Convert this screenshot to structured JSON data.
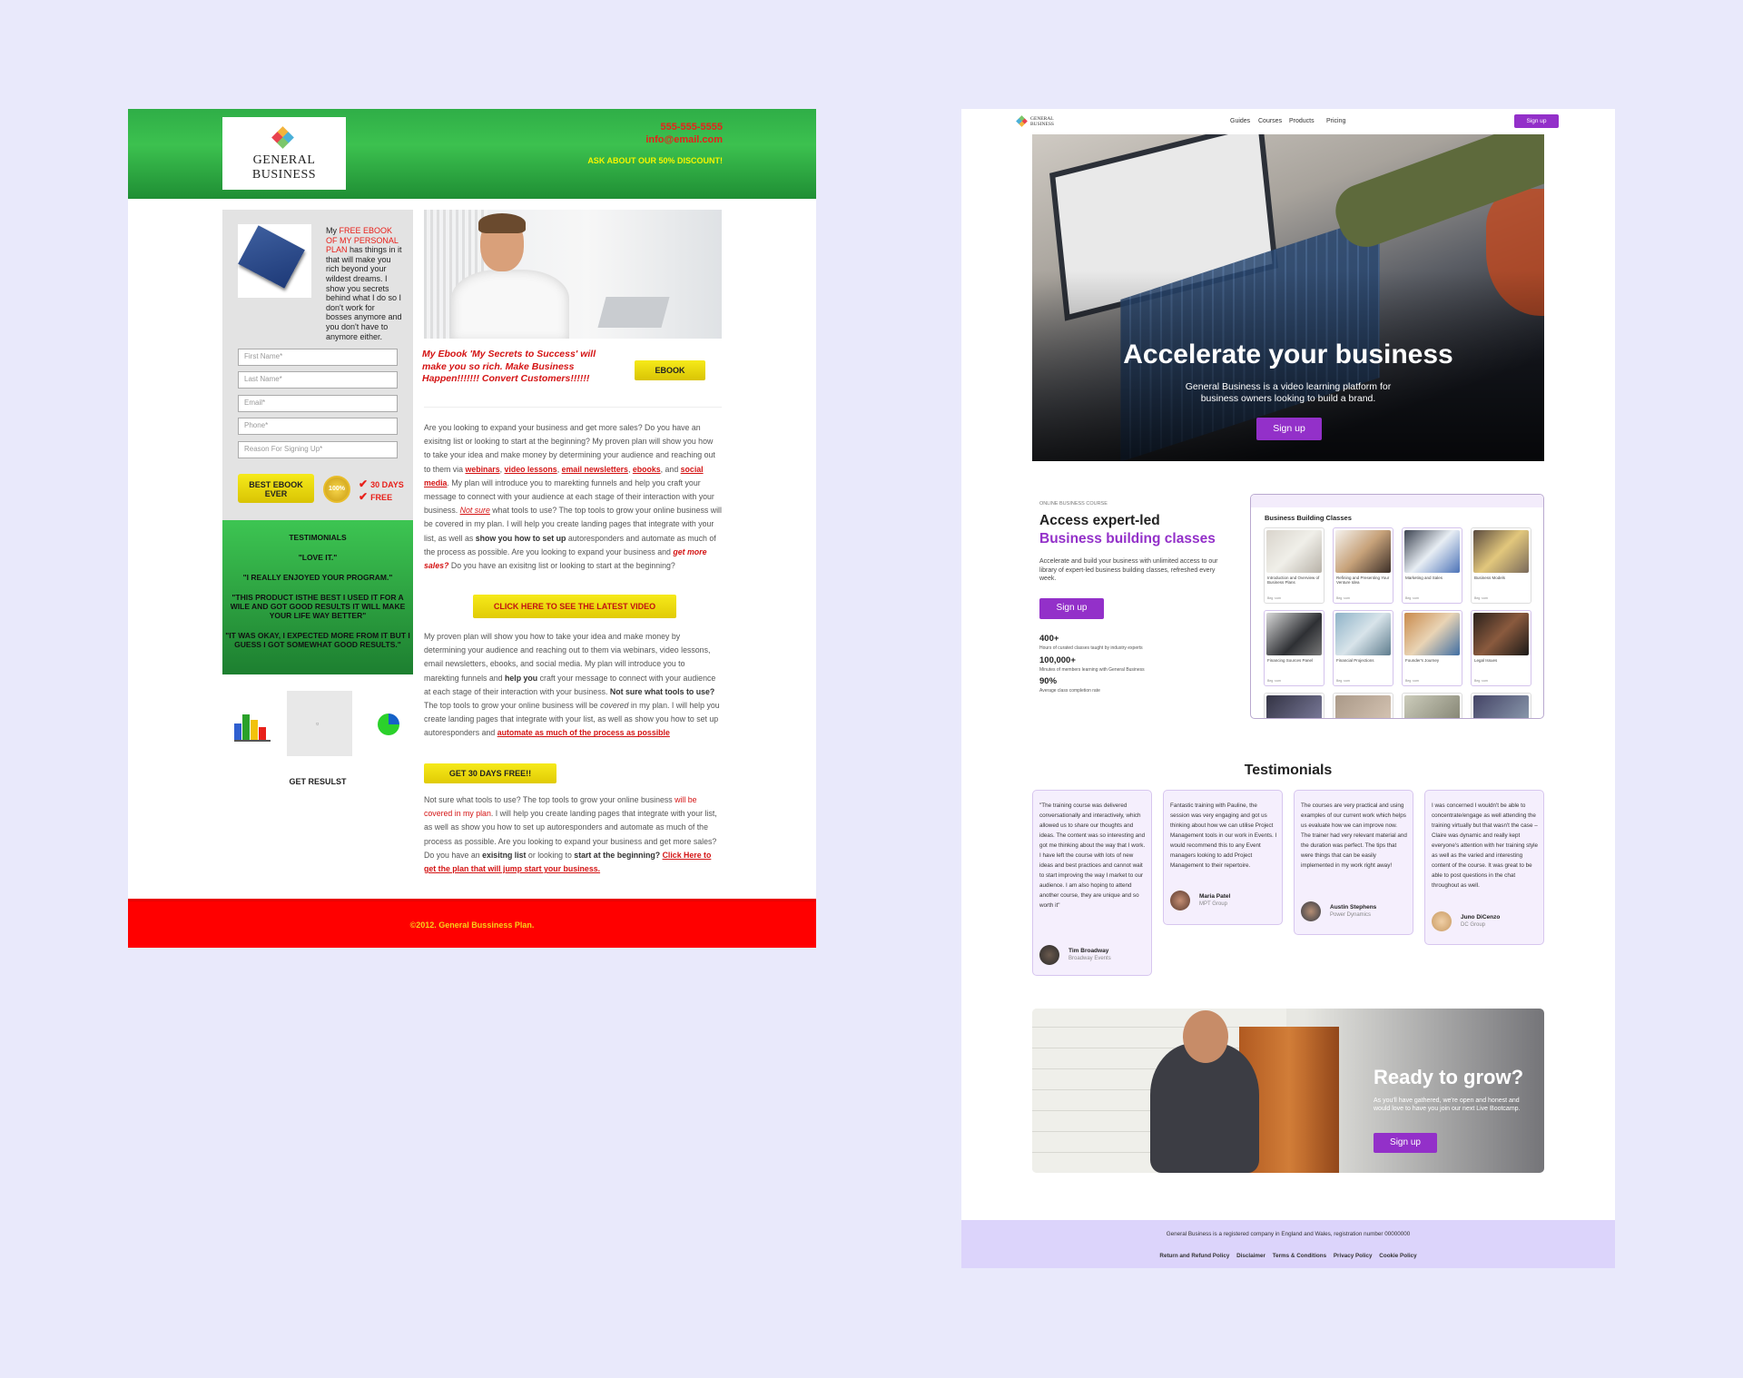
{
  "old_page": {
    "logo": {
      "line1": "GENERAL",
      "line2": "BUSINESS"
    },
    "contact": {
      "phone": "555-555-5555",
      "email": "info@email.com",
      "discount": "ASK ABOUT OUR 50% DISCOUNT!"
    },
    "sidebar": {
      "blurb_prefix": "My ",
      "blurb_highlight": "FREE EBOOK OF MY PERSONAL PLAN",
      "blurb_rest": " has things in it that will make you rich beyond your wildest dreams. I show you secrets behind what I do so I don't work for bosses anymore and you don't have to anymore either.",
      "fields": [
        "First Name*",
        "Last Name*",
        "Email*",
        "Phone*",
        "Reason For Signing Up*"
      ],
      "submit_label": "BEST EBOOK EVER",
      "medal_text": "100%",
      "checks": [
        "30 DAYS",
        "FREE"
      ]
    },
    "testimonials": {
      "title": "TESTIMONIALS",
      "quotes": [
        "\"LOVE IT.\"",
        "\"I REALLY ENJOYED YOUR PROGRAM.\"",
        "\"THIS PRODUCT ISTHE BEST I USED IT FOR A WILE AND GOT GOOD RESULTS IT WILL MAKE YOUR LIFE WAY BETTER\"",
        "\"IT WAS OKAY, I EXPECTED MORE FROM IT BUT I GUESS I GOT SOMEWHAT GOOD RESULTS.\""
      ]
    },
    "get_result": "GET RESULST",
    "tagline": "My Ebook 'My Secrets to Success' will make you so rich. Make Business Happen!!!!!!! Convert Customers!!!!!!",
    "ebook_button": "EBOOK",
    "para1": {
      "t1": "Are you looking to expand your business and get more sales? Do you have an exisitng list or looking to start at the beginning? My proven plan will show you how to take your idea and make money by determining your audience and reaching out to them via ",
      "l1": "webinars",
      "s1": ", ",
      "l2": "video lessons",
      "s2": ", ",
      "l3": "email newsletters",
      "s3": ", ",
      "l4": "ebooks",
      "s4": ", and ",
      "l5": "social media",
      "t2": ". My plan will introduce you to marekting funnels and help you craft your message to connect with your audience at each stage of their interaction with your business. ",
      "l6": "Not sure",
      "t3": " what tools to use? The top tools to grow your online business will be covered in my plan. I will help you create landing pages that integrate with your list, as well as ",
      "b1": "show you how to set up",
      "t4": " autoresponders and automate as much of the process as possible.  Are you looking to expand your business and ",
      "l7": "get more sales?",
      "t5": " Do you have an exisitng list or looking to start at the beginning?"
    },
    "video_button": "CLICK HERE TO SEE THE LATEST VIDEO",
    "para2": {
      "t1": "My proven plan will show you how to take your idea and make money by determining your audience and reaching out to them via webinars, video lessons, email newsletters, ebooks, and social media. My plan will introduce you to marekting funnels and ",
      "b1": "help you",
      "t2": " craft your message to connect with your audience at each stage of their interaction with your business. ",
      "b2": "Not sure what tools to use?",
      "t3": " The top tools to grow your online business will be ",
      "i1": "covered",
      "t4": " in my plan. I will help you create landing pages that integrate with your list, as well as show you how to set up autoresponders and ",
      "l1": "automate as much of the process as possible"
    },
    "free_button": "GET 30 DAYS FREE!!",
    "para3": {
      "t1": "Not sure what tools to use? The top tools to grow your online business ",
      "r1": "will be covered in my plan",
      "t2": ". I will help you create landing pages that integrate with your list, as well as show you how to set up autoresponders and automate as much of the process as possible.  Are you looking to expand your business and get more sales? Do you have an ",
      "b1": "exisitng list",
      "t3": " or looking to ",
      "b2": "start at the beginning?",
      "t4": " ",
      "l1": "Click Here to get the plan that will jump start your business."
    },
    "footer": "©2012. General Bussiness Plan."
  },
  "new_page": {
    "logo": {
      "line1": "GENERAL",
      "line2": "BUSINESS"
    },
    "nav": [
      "Guides",
      "Courses",
      "Products",
      "Pricing"
    ],
    "nav_signup": "Sign up",
    "hero": {
      "title": "Accelerate your business",
      "subtitle": "General Business is a video learning platform for business owners looking to build a brand.",
      "button": "Sign up"
    },
    "course": {
      "eyebrow": "ONLINE BUSINESS COURSE",
      "title1": "Access expert-led",
      "title2": "Business building classes",
      "description": "Accelerate and build your business with unlimited access to our library of expert-led business building classes, refreshed every week.",
      "button": "Sign up",
      "stats": [
        {
          "num": "400+",
          "label": "Hours of curated classes taught by industry experts"
        },
        {
          "num": "100,000+",
          "label": "Minutes of members learning with General Business"
        },
        {
          "num": "90%",
          "label": "Average class completion rate"
        }
      ]
    },
    "classes": {
      "title": "Business Building Classes",
      "items": [
        {
          "name": "Introduction and Overview of Business Plans",
          "meta": "Beg ·com"
        },
        {
          "name": "Refining and Presenting Your Venture Idea",
          "meta": "Beg ·com"
        },
        {
          "name": "Marketing and Sales",
          "meta": "Beg ·com"
        },
        {
          "name": "Business Models",
          "meta": "Beg ·com"
        },
        {
          "name": "Financing Sources Panel",
          "meta": "Beg ·com"
        },
        {
          "name": "Financial Projections",
          "meta": "Beg ·com"
        },
        {
          "name": "Founder's Journey",
          "meta": "Beg ·com"
        },
        {
          "name": "Legal Issues",
          "meta": "Beg ·com"
        }
      ]
    },
    "testimonials_heading": "Testimonials",
    "testimonials": [
      {
        "quote": "\"The training course was delivered conversationally and interactively, which allowed us to share our thoughts and ideas. The content was so interesting and got me thinking about the way that I work. I have left the course with lots of new ideas and best practices and cannot wait to start improving the way I market to our audience. I am also hoping to attend another course, they are unique and so worth it\"",
        "name": "Tim Broadway",
        "org": "Broadway Events"
      },
      {
        "quote": "Fantastic training with Pauline, the session was very engaging and got us thinking about how we can utilise Project Management tools in our work in Events. I would recommend this to any Event managers looking to add Project Management to their repertoire.",
        "name": "Maria Patel",
        "org": "MPT Group"
      },
      {
        "quote": "The courses are very practical and using examples of our current work which helps us evaluate how we can improve now. The trainer had very relevant material and the duration was perfect. The tips that were things that can be easily implemented in my work right away!",
        "name": "Austin Stephens",
        "org": "Power Dynamics"
      },
      {
        "quote": "I was concerned I wouldn't be able to concentrate/engage as well attending the training virtually but that wasn't the case – Claire was dynamic and really kept everyone's attention with her training style as well as the varied and interesting content of the course. It was great to be able to post questions in the chat throughout as well.",
        "name": "Juno DiCenzo",
        "org": "DC Group"
      }
    ],
    "grow": {
      "title": "Ready to grow?",
      "text": "As you'll have gathered, we're open and honest and would love to have you join our next Live Bootcamp.",
      "button": "Sign up"
    },
    "footer": {
      "registration": "General Business is a registered company in England and Wales, registration number 00000000",
      "links": [
        "Return and Refund Policy",
        "Disclaimer",
        "Terms & Conditions",
        "Privacy Policy",
        "Cookie Policy"
      ]
    }
  },
  "colors": {
    "old_green": "#2fae47",
    "old_red": "#ff0000",
    "old_yellow": "#f6ea1a",
    "new_purple": "#9330c9",
    "new_footer": "#dcd4fb",
    "background": "#e9e9fb"
  }
}
